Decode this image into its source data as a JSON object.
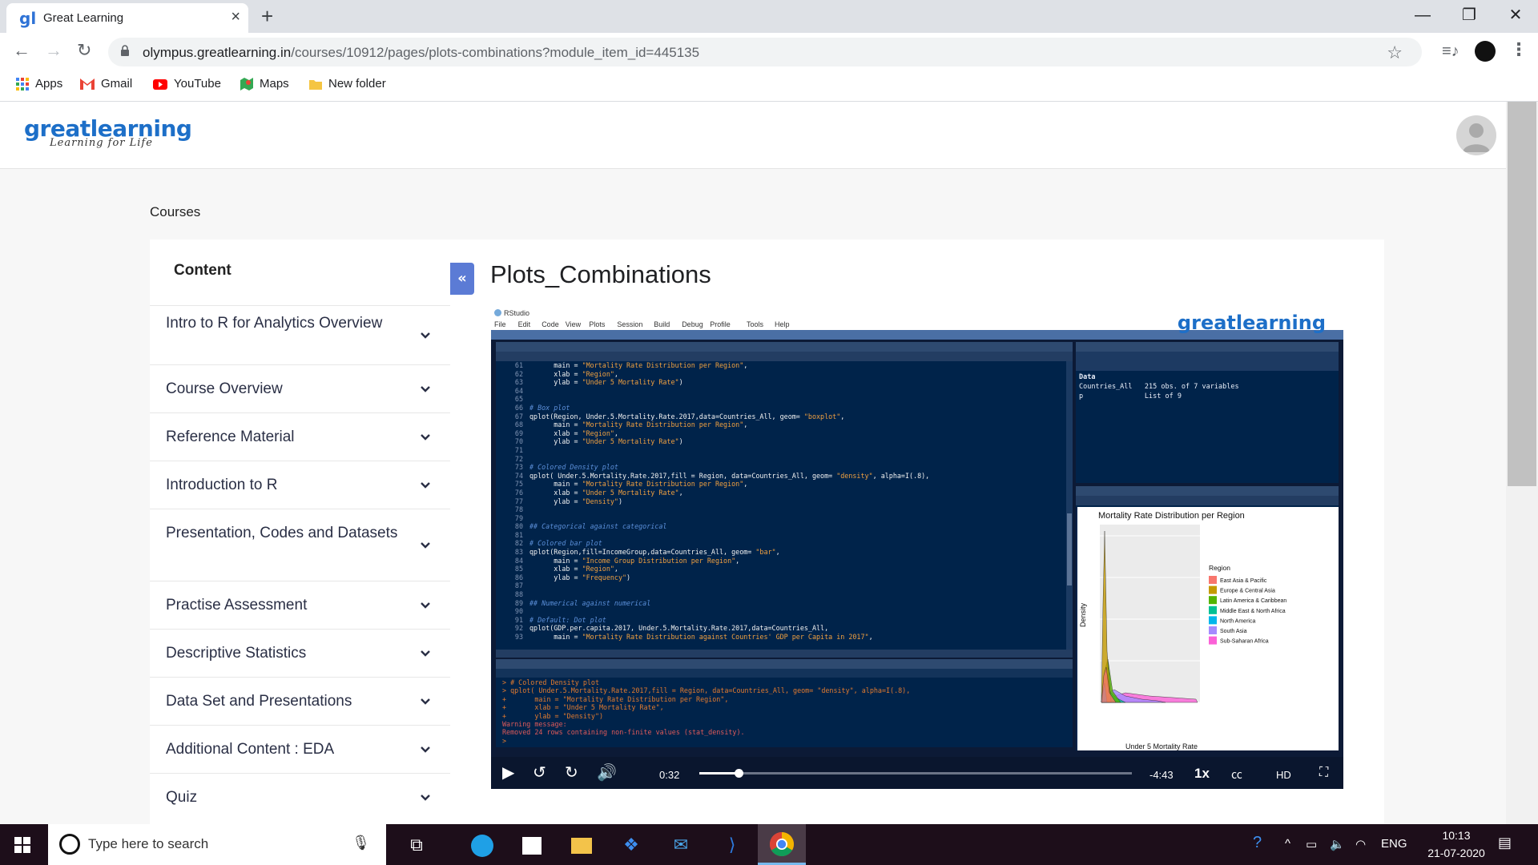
{
  "browser": {
    "tab_title": "Great Learning",
    "favicon": "gl-favicon",
    "url_host": "olympus.greatlearning.in",
    "url_path": "/courses/10912/pages/plots-combinations?module_item_id=445135",
    "bookmarks": [
      {
        "label": "Apps",
        "icon": "apps-grid-icon"
      },
      {
        "label": "Gmail",
        "icon": "gmail-icon"
      },
      {
        "label": "YouTube",
        "icon": "youtube-icon"
      },
      {
        "label": "Maps",
        "icon": "maps-icon"
      },
      {
        "label": "New folder",
        "icon": "folder-icon"
      }
    ]
  },
  "site": {
    "logo": "greatlearning",
    "tagline": "Learning for Life"
  },
  "breadcrumb": "Courses",
  "sidebar": {
    "title": "Content",
    "items": [
      {
        "label": "Intro to R for Analytics Overview"
      },
      {
        "label": "Course Overview"
      },
      {
        "label": "Reference Material"
      },
      {
        "label": "Introduction to R"
      },
      {
        "label": "Presentation, Codes and Datasets"
      },
      {
        "label": "Practise Assessment"
      },
      {
        "label": "Descriptive Statistics"
      },
      {
        "label": "Data Set and Presentations"
      },
      {
        "label": "Additional Content : EDA"
      },
      {
        "label": "Quiz"
      }
    ]
  },
  "collapse_label": "«",
  "page_title": "Plots_Combinations",
  "video": {
    "watermark": "greatlearning",
    "rstudio_title": "RStudio",
    "menu": [
      "File",
      "Edit",
      "Code",
      "View",
      "Plots",
      "Session",
      "Build",
      "Debug",
      "Profile",
      "Tools",
      "Help"
    ],
    "elapsed": "0:32",
    "remaining": "-4:43",
    "speed": "1x",
    "progress": 0.09,
    "plot_title": "Mortality Rate Distribution per Region",
    "plot_xlabel": "Under 5 Mortality Rate",
    "plot_ylabel": "Density",
    "legend_title": "Region",
    "legend": [
      {
        "name": "East Asia & Pacific",
        "color": "#f8766d"
      },
      {
        "name": "Europe & Central Asia",
        "color": "#c49a00"
      },
      {
        "name": "Latin America & Caribbean",
        "color": "#53b400"
      },
      {
        "name": "Middle East & North Africa",
        "color": "#00c094"
      },
      {
        "name": "North America",
        "color": "#00b6eb"
      },
      {
        "name": "South Asia",
        "color": "#a58aff"
      },
      {
        "name": "Sub-Saharan Africa",
        "color": "#fb61d7"
      }
    ],
    "env_rows": [
      "Countries_All   215 obs. of 7 variables",
      "p               List of 9"
    ]
  },
  "taskbar": {
    "search_placeholder": "Type here to search",
    "language": "ENG",
    "time": "10:13",
    "date": "21-07-2020"
  }
}
